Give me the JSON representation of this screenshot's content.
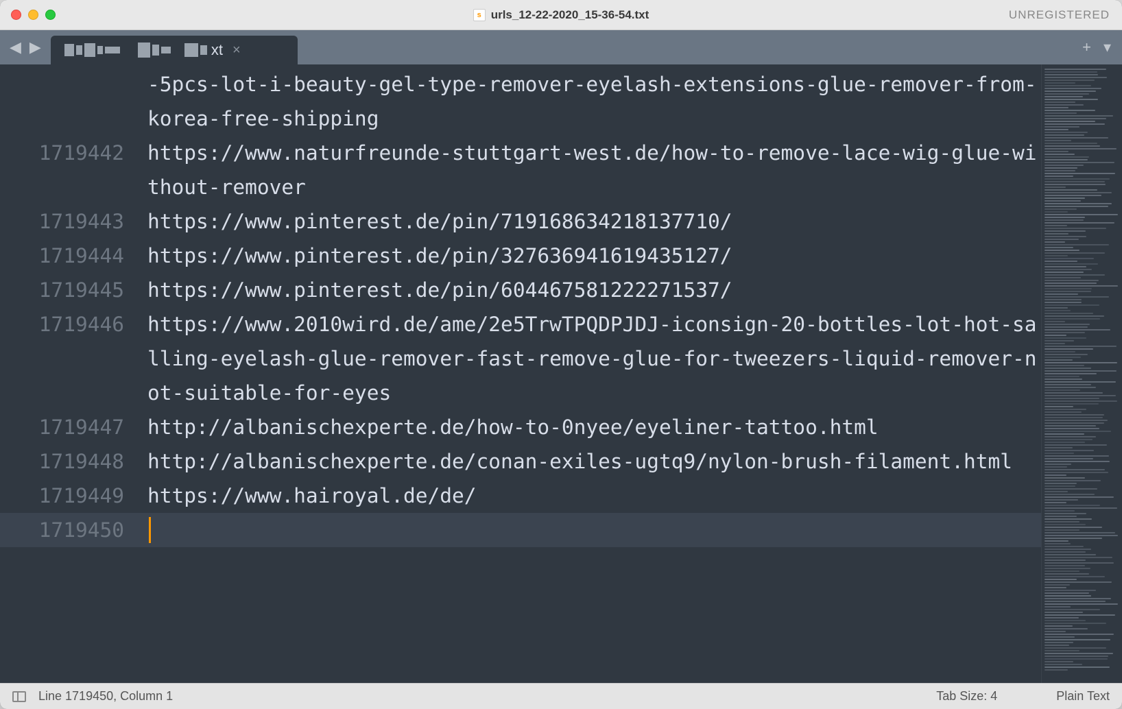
{
  "titlebar": {
    "filename": "urls_12-22-2020_15-36-54.txt",
    "unregistered": "UNREGISTERED"
  },
  "tab": {
    "ext": "xt",
    "close": "×"
  },
  "tabbar_icons": {
    "new": "+",
    "menu": "▾"
  },
  "lines": [
    {
      "num": "",
      "text": "-5pcs-lot-i-beauty-gel-type-remover-eyelash-extensions-glue-remover-from-korea-free-shipping"
    },
    {
      "num": "1719442",
      "text": "https://www.naturfreunde-stuttgart-west.de/how-to-remove-lace-wig-glue-without-remover"
    },
    {
      "num": "1719443",
      "text": "https://www.pinterest.de/pin/719168634218137710/"
    },
    {
      "num": "1719444",
      "text": "https://www.pinterest.de/pin/327636941619435127/"
    },
    {
      "num": "1719445",
      "text": "https://www.pinterest.de/pin/604467581222271537/"
    },
    {
      "num": "1719446",
      "text": "https://www.2010wird.de/ame/2e5TrwTPQDPJDJ-iconsign-20-bottles-lot-hot-salling-eyelash-glue-remover-fast-remove-glue-for-tweezers-liquid-remover-not-suitable-for-eyes"
    },
    {
      "num": "1719447",
      "text": "http://albanischexperte.de/how-to-0nyee/eyeliner-tattoo.html"
    },
    {
      "num": "1719448",
      "text": "http://albanischexperte.de/conan-exiles-ugtq9/nylon-brush-filament.html"
    },
    {
      "num": "1719449",
      "text": "https://www.hairoyal.de/de/"
    },
    {
      "num": "1719450",
      "text": "",
      "current": true
    }
  ],
  "status": {
    "position": "Line 1719450, Column 1",
    "tabsize": "Tab Size: 4",
    "syntax": "Plain Text"
  }
}
